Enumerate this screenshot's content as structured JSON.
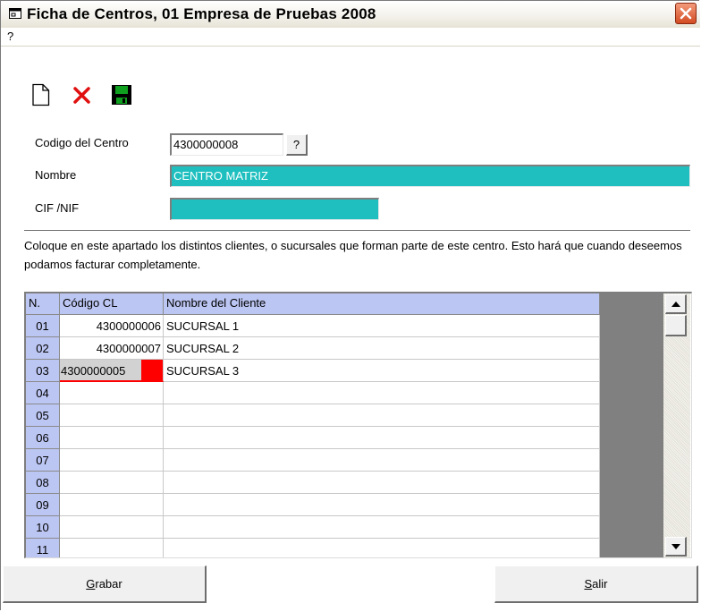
{
  "window": {
    "title": "Ficha de Centros, 01 Empresa de Pruebas 2008",
    "menu": [
      "?"
    ]
  },
  "toolbar": {
    "icons": [
      "new-document-icon",
      "delete-x-icon",
      "save-disk-icon"
    ]
  },
  "form": {
    "codigo_label": "Codigo del Centro",
    "codigo_value": "4300000008",
    "lookup_label": "?",
    "nombre_label": "Nombre",
    "nombre_value": "CENTRO MATRIZ",
    "cif_label": "CIF /NIF",
    "cif_value": ""
  },
  "description": "Coloque en este apartado los distintos clientes, o sucursales que forman parte de este centro. Esto hará que cuando deseemos podamos facturar completamente.",
  "grid": {
    "columns": [
      "N.",
      "Código CL",
      "Nombre del Cliente"
    ],
    "rows": [
      {
        "n": "01",
        "codigo": "4300000006",
        "nombre": "SUCURSAL 1"
      },
      {
        "n": "02",
        "codigo": "4300000007",
        "nombre": "SUCURSAL 2"
      },
      {
        "n": "03",
        "codigo": "4300000005",
        "nombre": "SUCURSAL 3"
      },
      {
        "n": "04",
        "codigo": "",
        "nombre": ""
      },
      {
        "n": "05",
        "codigo": "",
        "nombre": ""
      },
      {
        "n": "06",
        "codigo": "",
        "nombre": ""
      },
      {
        "n": "07",
        "codigo": "",
        "nombre": ""
      },
      {
        "n": "08",
        "codigo": "",
        "nombre": ""
      },
      {
        "n": "09",
        "codigo": "",
        "nombre": ""
      },
      {
        "n": "10",
        "codigo": "",
        "nombre": ""
      },
      {
        "n": "11",
        "codigo": "",
        "nombre": ""
      }
    ]
  },
  "buttons": {
    "grabar_first": "G",
    "grabar_rest": "rabar",
    "salir_first": "S",
    "salir_rest": "alir"
  },
  "colors": {
    "accent_field": "#1fbfbf",
    "grid_header": "#bcc6f2",
    "editing_cell": "#ff0000",
    "close_button": "#d24b22"
  }
}
